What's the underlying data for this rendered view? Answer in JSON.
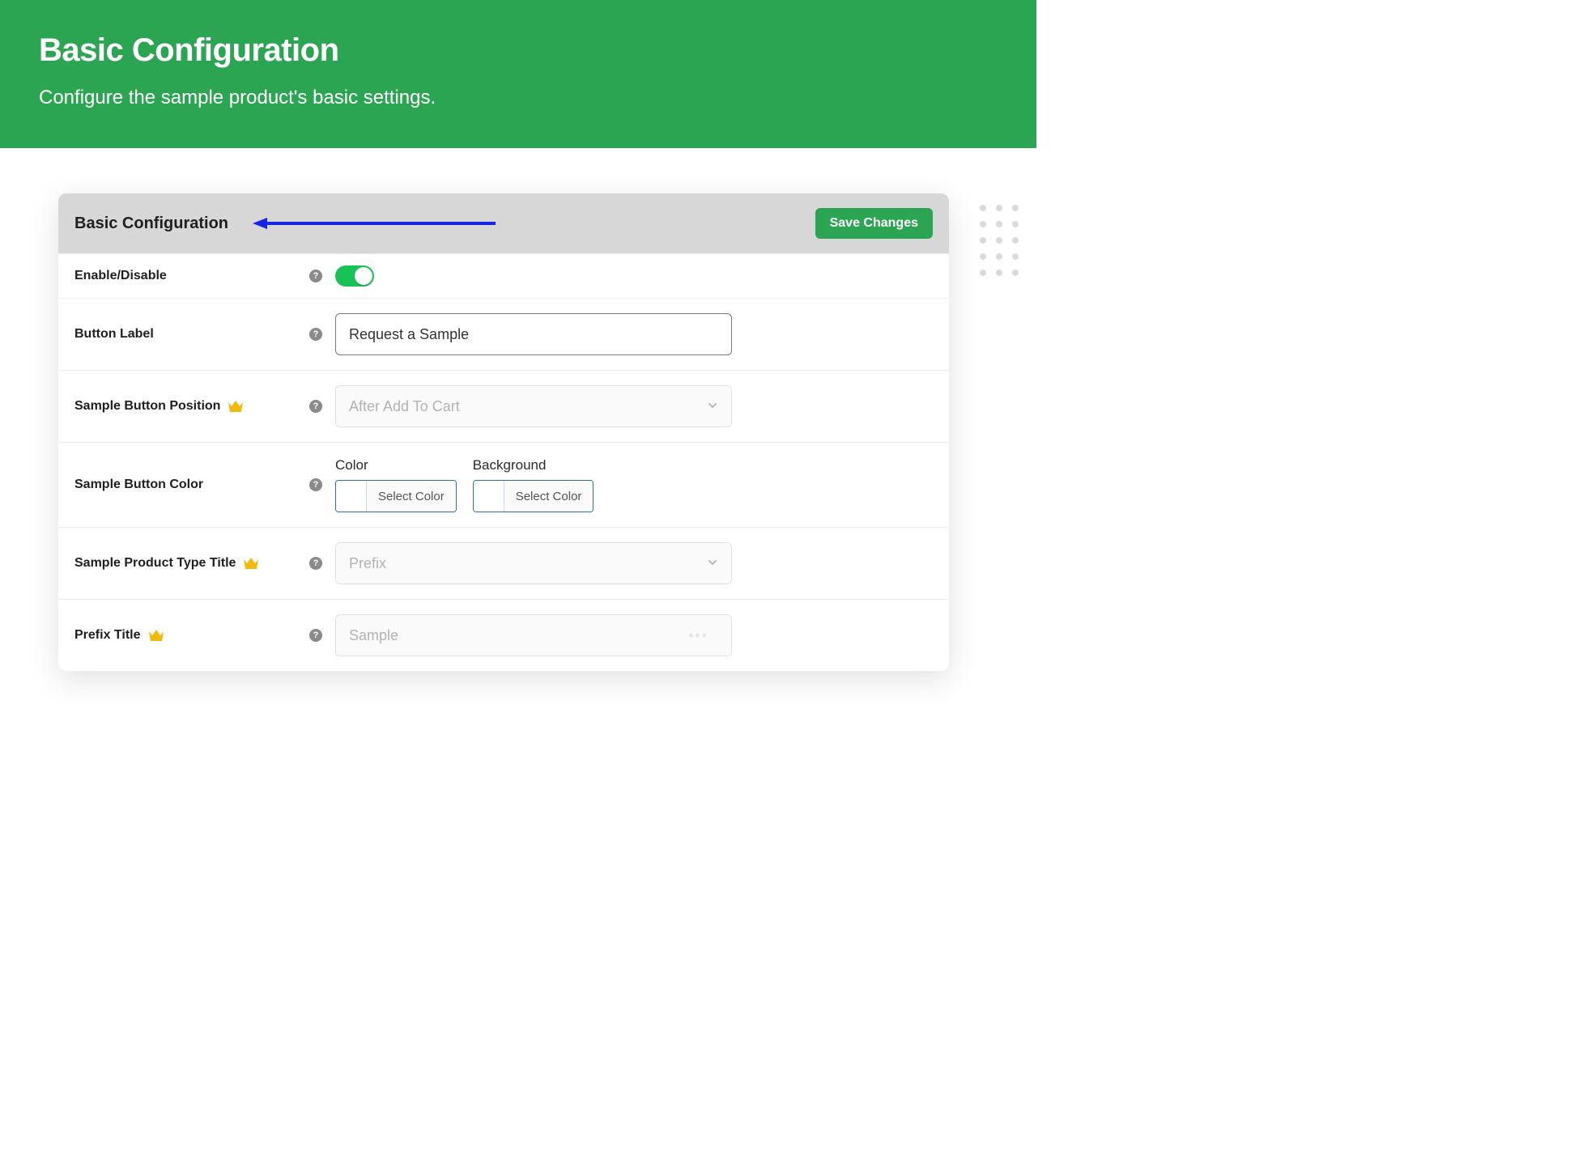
{
  "hero": {
    "title": "Basic Configuration",
    "subtitle": "Configure the sample product's basic settings."
  },
  "panel": {
    "title": "Basic Configuration",
    "save_label": "Save Changes"
  },
  "rows": {
    "enable": {
      "label": "Enable/Disable"
    },
    "button_label": {
      "label": "Button Label",
      "value": "Request a Sample"
    },
    "position": {
      "label": "Sample Button Position",
      "placeholder": "After Add To Cart"
    },
    "button_color": {
      "label": "Sample Button Color",
      "color_label": "Color",
      "background_label": "Background",
      "select_text": "Select Color"
    },
    "type_title": {
      "label": "Sample Product Type Title",
      "placeholder": "Prefix"
    },
    "prefix_title": {
      "label": "Prefix Title",
      "placeholder": "Sample"
    }
  }
}
